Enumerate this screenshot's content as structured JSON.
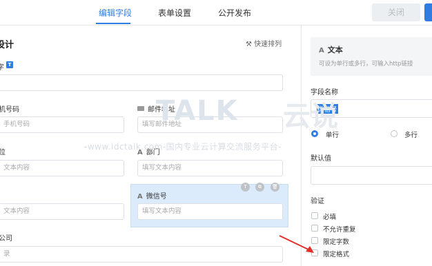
{
  "tabs": [
    {
      "label": "编辑字段",
      "active": true
    },
    {
      "label": "表单设置",
      "active": false
    },
    {
      "label": "公开发布",
      "active": false
    }
  ],
  "close_button": "关闭",
  "left": {
    "design_title": "设计",
    "quick_sort": "快速排列",
    "row1_label": "字",
    "row1_badge": "T",
    "fields": {
      "phone_label": "机号码",
      "phone_placeholder": "手机号码",
      "email_label": "邮件地址",
      "email_placeholder": "填写邮件地址",
      "f3_label": "位",
      "f3_placeholder": "文本内容",
      "dept_label": "部门",
      "dept_placeholder": "填写文本内容",
      "f5_placeholder": "文本内容",
      "wechat_label": "微信号",
      "wechat_placeholder": "填写文本内容",
      "company_label": "公司",
      "company_placeholder": "录"
    },
    "tool_icons": [
      "T",
      "⧉",
      "🗑"
    ]
  },
  "right": {
    "field_type": "文本",
    "field_type_desc": "可设为单行或多行，可输入http链接",
    "name_label": "字段名称",
    "name_value": "微信号",
    "radio_single": "单行",
    "radio_multi": "多行",
    "default_label": "默认值",
    "validate_label": "验证",
    "checks": [
      "必填",
      "不允许重复",
      "限定字数",
      "限定格式"
    ]
  },
  "watermark": {
    "brand": "TALK",
    "brand_cn": "云说",
    "url_text": "-www.idctalk.com-国内专业云计算交流服务平台-"
  },
  "colors": {
    "accent": "#2f7de1",
    "arrow": "#e0302a"
  }
}
